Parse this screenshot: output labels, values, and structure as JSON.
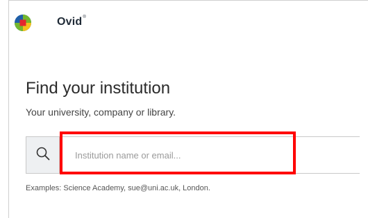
{
  "header": {
    "brand_name": "Ovid",
    "brand_mark": "®"
  },
  "icons": {
    "logo": "ovid-logo-icon",
    "search": "search-icon"
  },
  "main": {
    "title": "Find your institution",
    "subtitle": "Your university, company or library.",
    "search": {
      "value": "",
      "placeholder": "Institution name or email..."
    },
    "examples": "Examples: Science Academy, sue@uni.ac.uk, London."
  },
  "colors": {
    "highlight": "#ff0000",
    "logo_red": "#e3262f",
    "logo_green": "#74b72e",
    "logo_blue": "#1f5fa8",
    "logo_yellow": "#f3c21b"
  }
}
